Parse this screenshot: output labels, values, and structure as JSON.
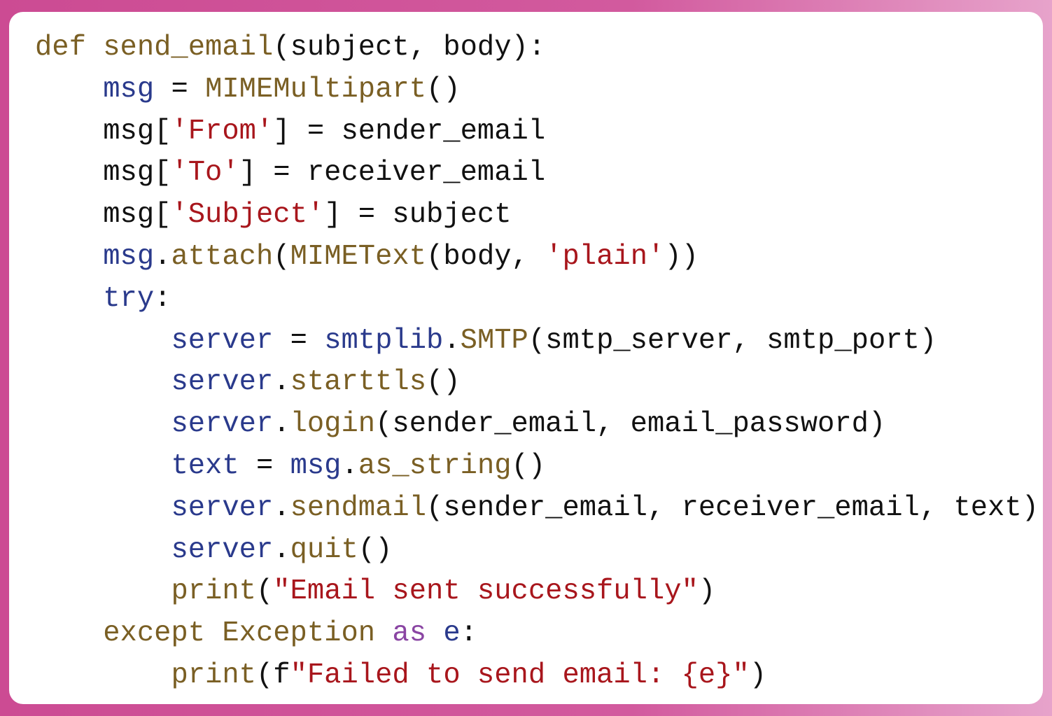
{
  "colors": {
    "keyword": "#7a5f24",
    "variable": "#2a3a8c",
    "string": "#a8161c",
    "as_keyword": "#8a45a3",
    "default": "#111111",
    "background": "#cc4b93"
  },
  "code_lines": [
    [
      [
        "def ",
        "k"
      ],
      [
        "send_email",
        "k"
      ],
      [
        "(subject, body):",
        "d"
      ]
    ],
    [
      [
        "    ",
        "d"
      ],
      [
        "msg",
        "v"
      ],
      [
        " = ",
        "d"
      ],
      [
        "MIMEMultipart",
        "k"
      ],
      [
        "()",
        "d"
      ]
    ],
    [
      [
        "    msg[",
        "d"
      ],
      [
        "'From'",
        "s"
      ],
      [
        "] = sender_email",
        "d"
      ]
    ],
    [
      [
        "    msg[",
        "d"
      ],
      [
        "'To'",
        "s"
      ],
      [
        "] = receiver_email",
        "d"
      ]
    ],
    [
      [
        "    msg[",
        "d"
      ],
      [
        "'Subject'",
        "s"
      ],
      [
        "] = subject",
        "d"
      ]
    ],
    [
      [
        "    ",
        "d"
      ],
      [
        "msg",
        "v"
      ],
      [
        ".",
        "d"
      ],
      [
        "attach",
        "k"
      ],
      [
        "(",
        "d"
      ],
      [
        "MIMEText",
        "k"
      ],
      [
        "(body, ",
        "d"
      ],
      [
        "'plain'",
        "s"
      ],
      [
        "))",
        "d"
      ]
    ],
    [
      [
        "    ",
        "d"
      ],
      [
        "try",
        "v"
      ],
      [
        ":",
        "d"
      ]
    ],
    [
      [
        "        ",
        "d"
      ],
      [
        "server",
        "v"
      ],
      [
        " = ",
        "d"
      ],
      [
        "smtplib",
        "v"
      ],
      [
        ".",
        "d"
      ],
      [
        "SMTP",
        "k"
      ],
      [
        "(smtp_server, smtp_port)",
        "d"
      ]
    ],
    [
      [
        "        ",
        "d"
      ],
      [
        "server",
        "v"
      ],
      [
        ".",
        "d"
      ],
      [
        "starttls",
        "k"
      ],
      [
        "()",
        "d"
      ]
    ],
    [
      [
        "        ",
        "d"
      ],
      [
        "server",
        "v"
      ],
      [
        ".",
        "d"
      ],
      [
        "login",
        "k"
      ],
      [
        "(sender_email, email_password)",
        "d"
      ]
    ],
    [
      [
        "        ",
        "d"
      ],
      [
        "text",
        "v"
      ],
      [
        " = ",
        "d"
      ],
      [
        "msg",
        "v"
      ],
      [
        ".",
        "d"
      ],
      [
        "as_string",
        "k"
      ],
      [
        "()",
        "d"
      ]
    ],
    [
      [
        "        ",
        "d"
      ],
      [
        "server",
        "v"
      ],
      [
        ".",
        "d"
      ],
      [
        "sendmail",
        "k"
      ],
      [
        "(sender_email, receiver_email, text)",
        "d"
      ]
    ],
    [
      [
        "        ",
        "d"
      ],
      [
        "server",
        "v"
      ],
      [
        ".",
        "d"
      ],
      [
        "quit",
        "k"
      ],
      [
        "()",
        "d"
      ]
    ],
    [
      [
        "        ",
        "d"
      ],
      [
        "print",
        "k"
      ],
      [
        "(",
        "d"
      ],
      [
        "\"Email sent successfully\"",
        "s"
      ],
      [
        ")",
        "d"
      ]
    ],
    [
      [
        "    ",
        "d"
      ],
      [
        "except Exception ",
        "k"
      ],
      [
        "as",
        "p"
      ],
      [
        " ",
        "d"
      ],
      [
        "e",
        "v"
      ],
      [
        ":",
        "d"
      ]
    ],
    [
      [
        "        ",
        "d"
      ],
      [
        "print",
        "k"
      ],
      [
        "(f",
        "d"
      ],
      [
        "\"Failed to send email: {e}\"",
        "s"
      ],
      [
        ")",
        "d"
      ]
    ]
  ]
}
